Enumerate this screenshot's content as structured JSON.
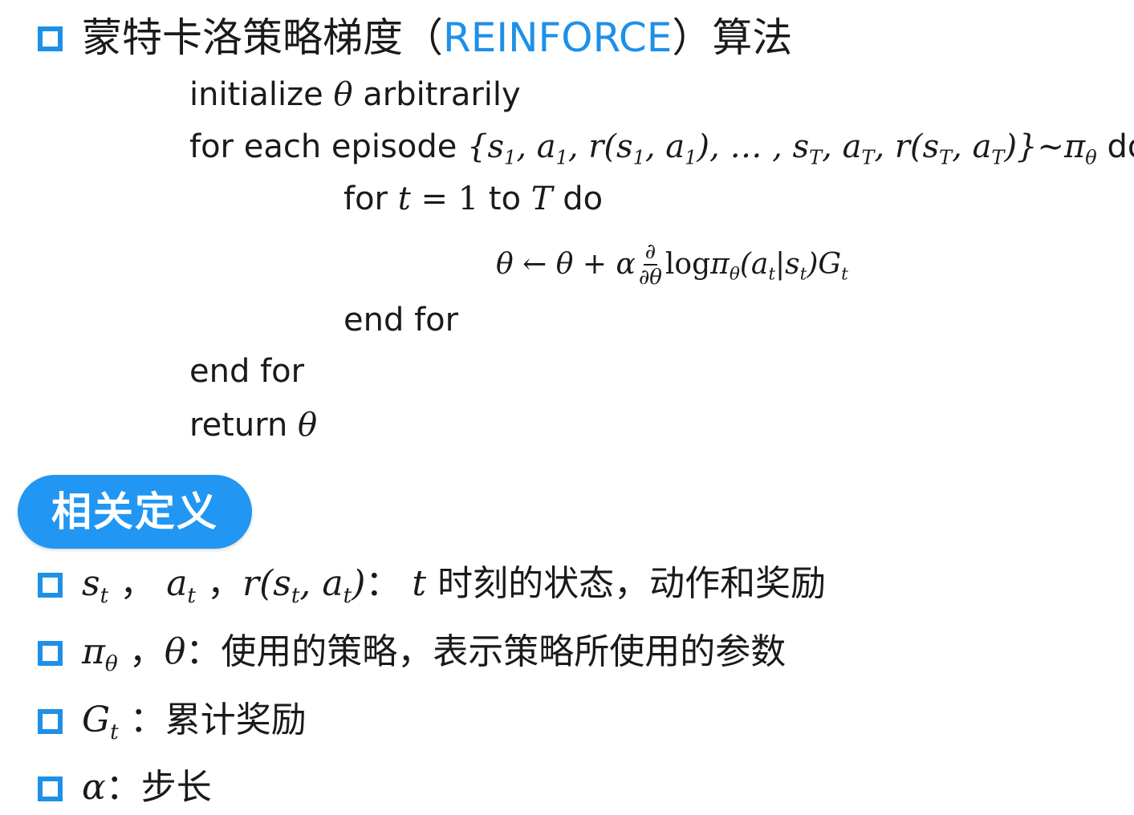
{
  "title": {
    "prefix": "蒙特卡洛策略梯度（",
    "accent": "REINFORCE",
    "suffix": "）算法"
  },
  "algorithm": {
    "line1": "initialize θ arbitrarily",
    "line2_text": "for each episode",
    "line2_math": "{s₁, a₁, r(s₁, a₁), … , s_T, a_T, r(s_T, a_T)}~π_θ",
    "line2_end": "do",
    "line3_for": "for",
    "line3_math": "t = 1",
    "line3_to": "to",
    "line3_T": "T",
    "line3_do": "do",
    "update": "θ ← θ + α ∂/∂θ logπ_θ(a_t|s_t)G_t",
    "line5": "end for",
    "line6": "end for",
    "line7": "return θ"
  },
  "section_badge": "相关定义",
  "definitions": [
    {
      "symbol": "s_t ， a_t ，r(s_t, a_t)：",
      "text": "t 时刻的状态，动作和奖励"
    },
    {
      "symbol": "π_θ ，θ：",
      "text": "使用的策略，表示策略所使用的参数"
    },
    {
      "symbol": "G_t ：",
      "text": "累计奖励"
    },
    {
      "symbol": "α：",
      "text": "步长"
    }
  ],
  "colors": {
    "accent": "#1e90e8",
    "badge_bg": "#2196f3",
    "text": "#1a1a1a"
  }
}
